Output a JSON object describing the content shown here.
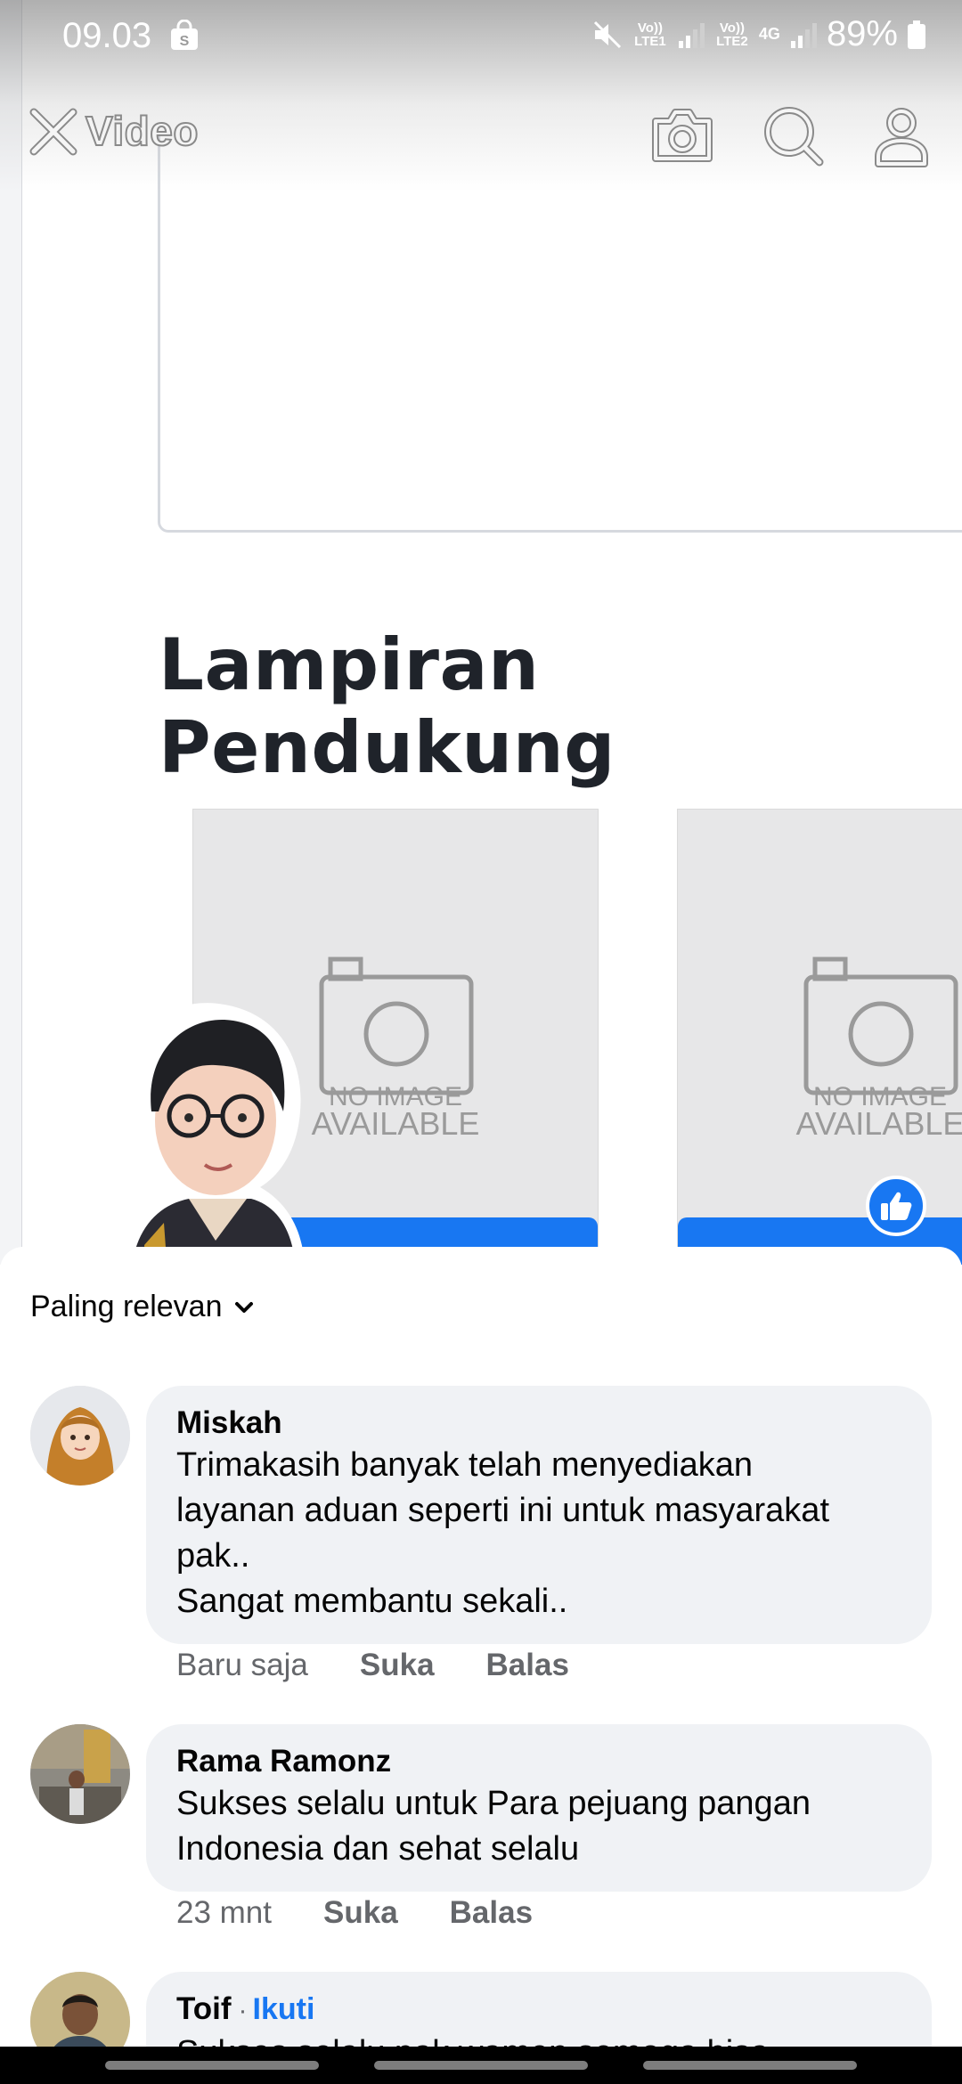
{
  "status_bar": {
    "time": "09.03",
    "sim1_label": "Vo)) LTE1",
    "sim2_label": "Vo)) LTE2",
    "network": "4G",
    "battery": "89%",
    "icons": [
      "shopping-bag-icon",
      "mute-icon",
      "signal-icon",
      "battery-icon"
    ]
  },
  "toolbar": {
    "title": "Video",
    "icons": [
      "close-icon",
      "camera-icon",
      "search-icon",
      "profile-icon"
    ]
  },
  "video": {
    "section_title": "Lampiran Pendukung",
    "cards": [
      {
        "line1": "NO IMAGE",
        "line2": "AVAILABLE"
      },
      {
        "line1": "NO IMAGE",
        "line2": "AVAILABLE"
      }
    ]
  },
  "comments_sheet": {
    "sort_label": "Paling relevan",
    "comments": [
      {
        "name": "Miskah",
        "text": "Trimakasih banyak telah menyediakan\nlayanan aduan seperti ini untuk masyarakat\npak..\nSangat membantu sekali..",
        "time": "Baru saja",
        "like": "Suka",
        "reply": "Balas"
      },
      {
        "name": "Rama Ramonz",
        "text": "Sukses selalu untuk Para pejuang pangan\nIndonesia dan sehat selalu",
        "time": "23 mnt",
        "like": "Suka",
        "reply": "Balas"
      },
      {
        "name": "Toif",
        "separator": "·",
        "follow": "Ikuti",
        "text": "Sukses selalu pak,wamen semoga bisa"
      }
    ]
  },
  "colors": {
    "accent": "#1877f2",
    "bubble": "#f0f2f5",
    "meta_text": "#65676b"
  }
}
